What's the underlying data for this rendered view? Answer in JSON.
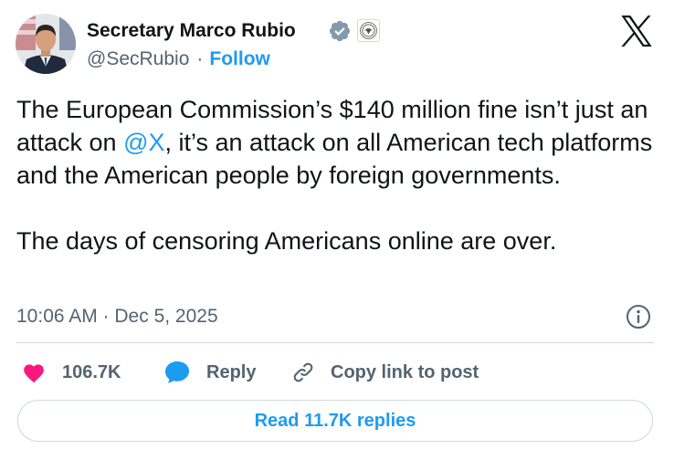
{
  "author": {
    "name": "Secretary Marco Rubio",
    "handle": "@SecRubio",
    "separator": "·",
    "follow_label": "Follow",
    "verified_badge_icon": "verified-check-icon",
    "affiliation_badge_icon": "state-department-seal-icon"
  },
  "brand": {
    "logo_icon": "x-logo-icon"
  },
  "tweet": {
    "text_part1": "The European Commission’s $140 million fine isn’t just an attack on ",
    "mention": "@X",
    "text_part2": ", it’s an attack on all American tech platforms and the American people by foreign governments.",
    "paragraph2": "The days of censoring Americans online are over.",
    "timestamp": "10:06 AM · Dec 5, 2025"
  },
  "actions": {
    "like_count": "106.7K",
    "reply_label": "Reply",
    "copy_link_label": "Copy link to post",
    "read_replies_label": "Read 11.7K replies"
  },
  "colors": {
    "accent": "#1d9bf0",
    "like": "#f91880",
    "text_primary": "#0f1419",
    "text_secondary": "#536471",
    "border": "#cfd9de"
  }
}
